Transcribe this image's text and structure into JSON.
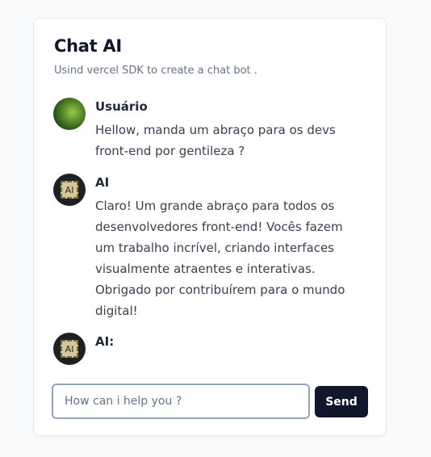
{
  "card": {
    "title": "Chat AI",
    "subtitle": "Usind vercel SDK to create a chat bot ."
  },
  "messages": [
    {
      "author": "Usuário",
      "avatar_icon": "parrot-avatar",
      "text": "Hellow, manda um abraço para os devs front-end por gentileza ?"
    },
    {
      "author": "AI",
      "avatar_icon": "ai-avatar",
      "avatar_label": "AI",
      "text": "Claro! Um grande abraço para todos os desenvolvedores front-end! Vocês fazem um trabalho incrível, criando interfaces visualmente atraentes e interativas. Obrigado por contribuírem para o mundo digital!"
    },
    {
      "author": "AI:",
      "avatar_icon": "ai-avatar",
      "avatar_label": "AI",
      "text": ""
    }
  ],
  "composer": {
    "value": "",
    "placeholder": "How can i help you ?",
    "send_label": "Send"
  },
  "colors": {
    "accent": "#0f172a",
    "background": "#f9fafb",
    "card": "#ffffff",
    "input_border": "#94a3b8"
  }
}
